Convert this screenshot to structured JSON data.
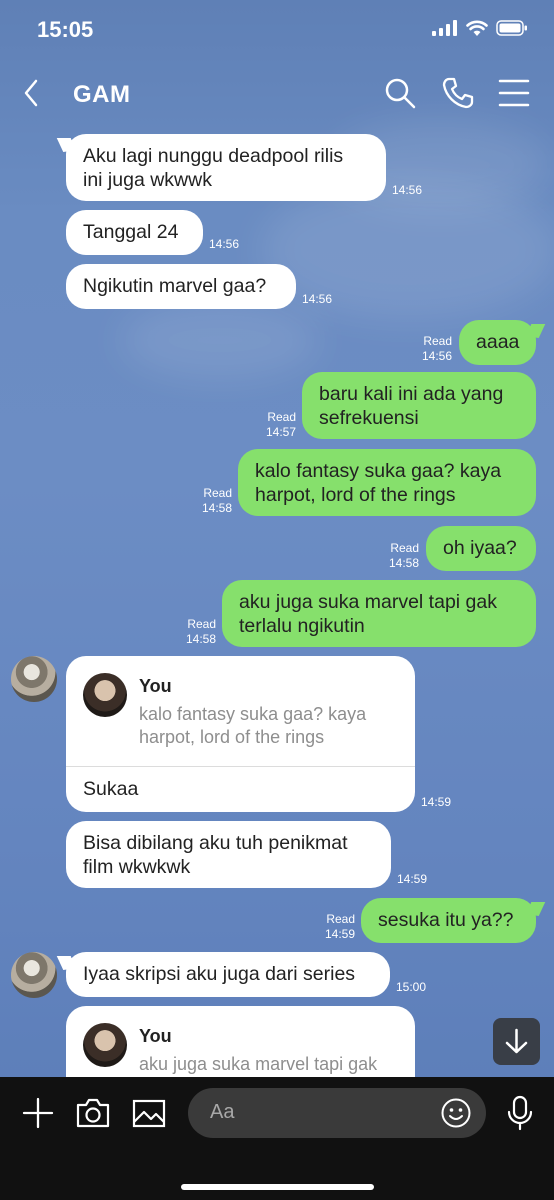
{
  "status_bar": {
    "time": "15:05"
  },
  "header": {
    "title": "GAM"
  },
  "messages": [
    {
      "text": "Aku lagi nunggu deadpool rilis\nini juga wkwwk",
      "time": "14:56"
    },
    {
      "text": "Tanggal 24",
      "time": "14:56"
    },
    {
      "text": "Ngikutin marvel gaa?",
      "time": "14:56"
    },
    {
      "text": "aaaa",
      "read": "Read",
      "time": "14:56"
    },
    {
      "text": "baru kali ini ada yang\nsefrekuensi",
      "read": "Read",
      "time": "14:57"
    },
    {
      "text": "kalo fantasy suka gaa? kaya\nharpot, lord of the rings",
      "read": "Read",
      "time": "14:58"
    },
    {
      "text": "oh iyaa?",
      "read": "Read",
      "time": "14:58"
    },
    {
      "text": "aku juga suka marvel tapi gak\nterlalu ngikutin",
      "read": "Read",
      "time": "14:58"
    },
    {
      "reply_name": "You",
      "reply_quote": "kalo fantasy suka gaa? kaya\nharpot, lord of the rings",
      "text": "Sukaa",
      "time": "14:59"
    },
    {
      "text": "Bisa dibilang aku tuh penikmat\nfilm wkwkwk",
      "time": "14:59"
    },
    {
      "text": "sesuka itu ya??",
      "read": "Read",
      "time": "14:59"
    },
    {
      "text": "Iyaa skripsi aku juga dari series",
      "time": "15:00"
    },
    {
      "reply_name": "You",
      "reply_quote": "aku juga suka marvel tapi gak"
    }
  ],
  "input": {
    "placeholder": "Aa"
  },
  "colors": {
    "outgoing": "#86e06c",
    "incoming": "#ffffff",
    "background": "#6a8cc2"
  }
}
